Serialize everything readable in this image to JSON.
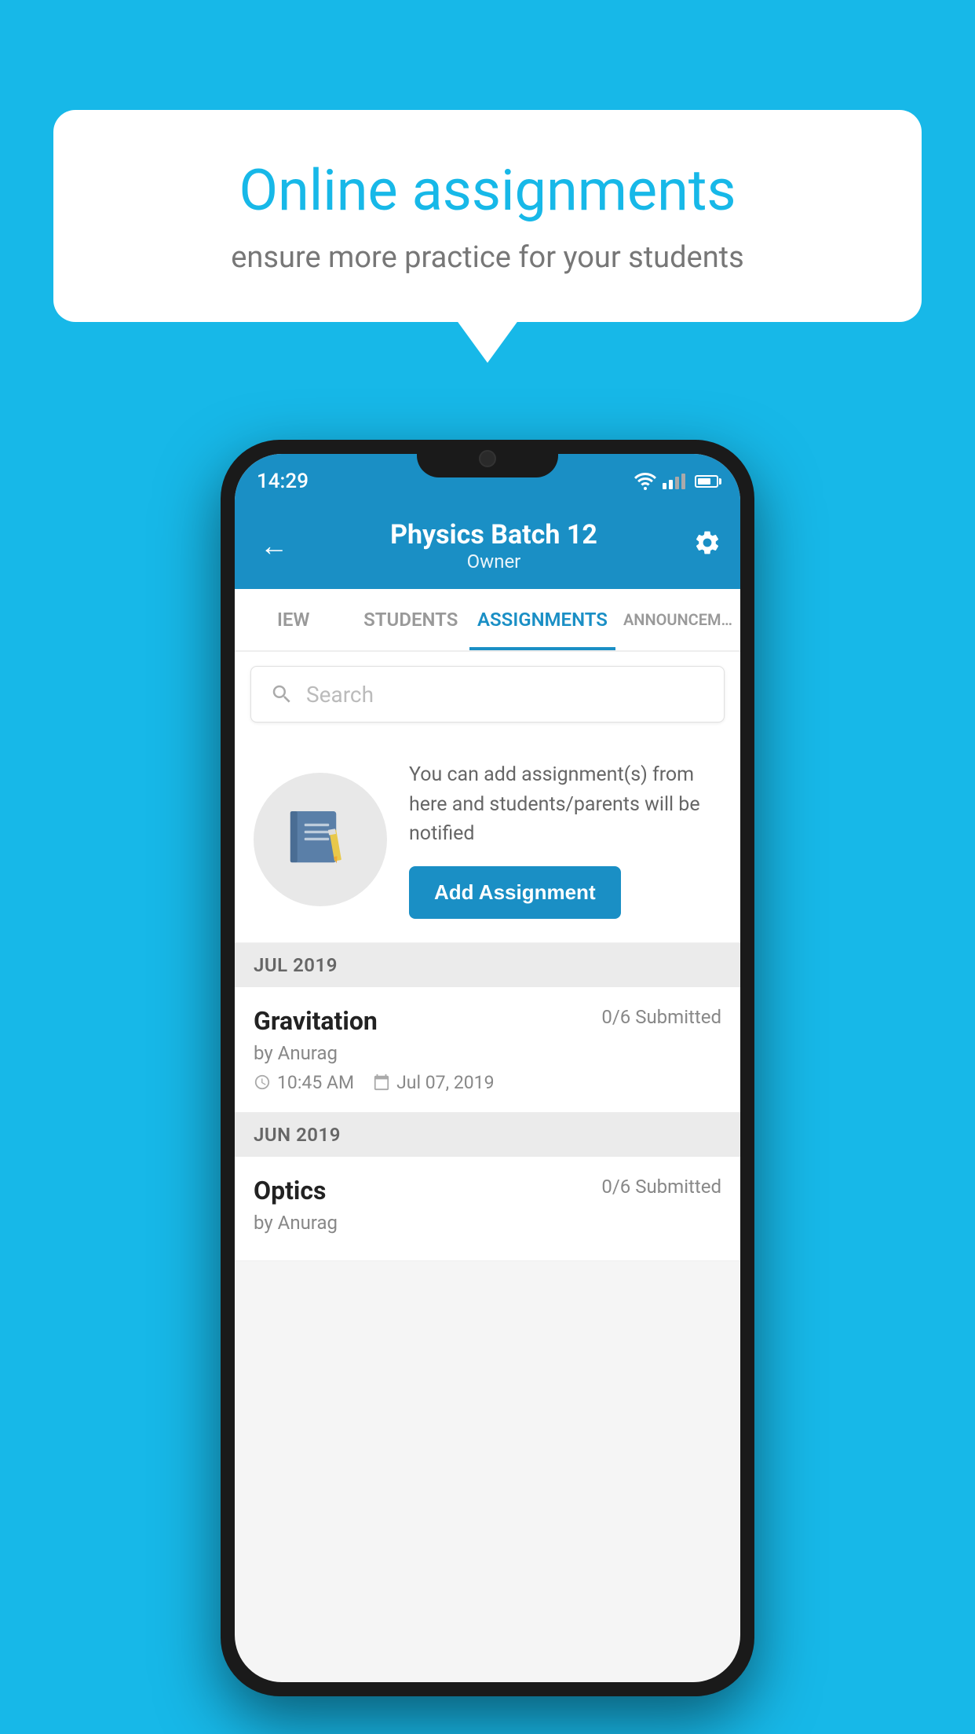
{
  "background_color": "#17b8e8",
  "speech_bubble": {
    "title": "Online assignments",
    "subtitle": "ensure more practice for your students"
  },
  "status_bar": {
    "time": "14:29"
  },
  "app_bar": {
    "title": "Physics Batch 12",
    "subtitle": "Owner"
  },
  "tabs": [
    {
      "label": "IEW",
      "active": false
    },
    {
      "label": "STUDENTS",
      "active": false
    },
    {
      "label": "ASSIGNMENTS",
      "active": true
    },
    {
      "label": "ANNOUNCEM…",
      "active": false
    }
  ],
  "search": {
    "placeholder": "Search"
  },
  "empty_state": {
    "description": "You can add assignment(s) from here and students/parents will be notified",
    "button_label": "Add Assignment"
  },
  "assignments": [
    {
      "section": "JUL 2019",
      "items": [
        {
          "name": "Gravitation",
          "submitted": "0/6 Submitted",
          "by": "by Anurag",
          "time": "10:45 AM",
          "date": "Jul 07, 2019"
        }
      ]
    },
    {
      "section": "JUN 2019",
      "items": [
        {
          "name": "Optics",
          "submitted": "0/6 Submitted",
          "by": "by Anurag",
          "time": "",
          "date": ""
        }
      ]
    }
  ]
}
